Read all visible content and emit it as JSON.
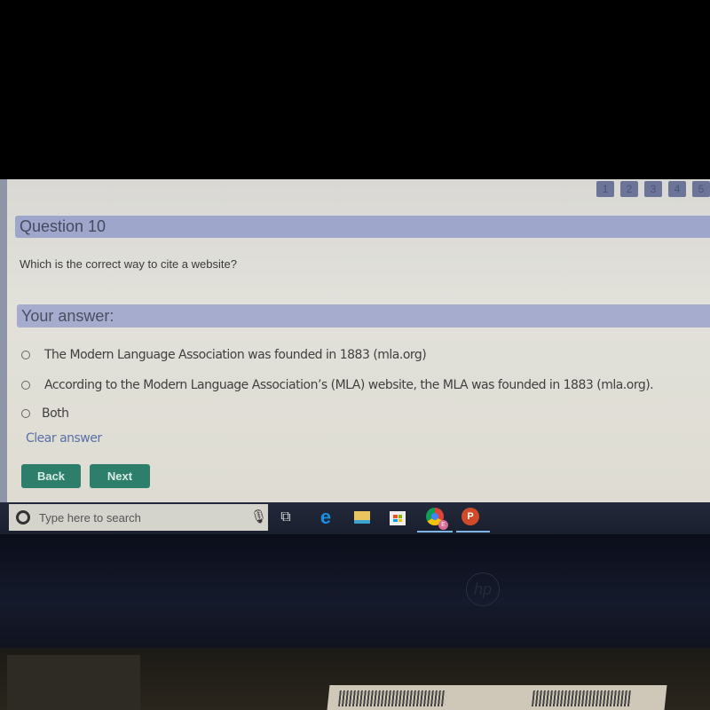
{
  "pager": {
    "pages": [
      "1",
      "2",
      "3",
      "4",
      "5"
    ]
  },
  "question": {
    "title": "Question 10",
    "text": "Which is the correct way to cite a website?"
  },
  "answer": {
    "header": "Your answer:",
    "options": [
      "The Modern Language Association was founded in 1883 (mla.org)",
      "According to the Modern Language Association’s (MLA) website, the MLA was founded in 1883 (mla.org).",
      "Both"
    ],
    "clear_label": "Clear answer"
  },
  "nav": {
    "back_label": "Back",
    "next_label": "Next"
  },
  "taskbar": {
    "search_placeholder": "Type here to search",
    "chrome_badge": "E",
    "ppt_label": "P"
  },
  "colors": {
    "header_bar": "#9ea6cc",
    "button": "#2d7f6c",
    "link": "#5a6fa8",
    "pager": "#6c7598"
  }
}
